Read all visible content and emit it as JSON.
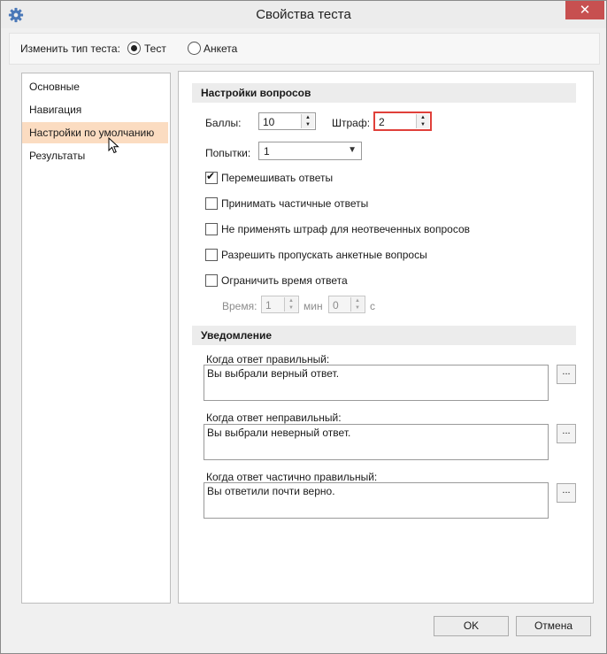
{
  "window": {
    "title": "Свойства теста",
    "icon": "gear-icon",
    "close_label": "✕"
  },
  "test_type": {
    "label": "Изменить тип теста:",
    "options": [
      {
        "label": "Тест",
        "selected": true
      },
      {
        "label": "Анкета",
        "selected": false
      }
    ]
  },
  "nav": {
    "items": [
      {
        "label": "Основные"
      },
      {
        "label": "Навигация"
      },
      {
        "label": "Настройки по умолчанию",
        "selected": true
      },
      {
        "label": "Результаты"
      }
    ]
  },
  "questions": {
    "header": "Настройки вопросов",
    "points_label": "Баллы:",
    "points_value": "10",
    "penalty_label": "Штраф:",
    "penalty_value": "2",
    "attempts_label": "Попытки:",
    "attempts_value": "1",
    "checkboxes": [
      {
        "label": "Перемешивать ответы",
        "checked": true
      },
      {
        "label": "Принимать частичные ответы",
        "checked": false
      },
      {
        "label": "Не применять штраф для неотвеченных вопросов",
        "checked": false
      },
      {
        "label": "Разрешить пропускать анкетные вопросы",
        "checked": false
      },
      {
        "label": "Ограничить время ответа",
        "checked": false
      }
    ],
    "time_label": "Время:",
    "time_min_value": "1",
    "time_min_unit": "мин",
    "time_sec_value": "0",
    "time_sec_unit": "с"
  },
  "notification": {
    "header": "Уведомление",
    "correct_label": "Когда ответ правильный:",
    "correct_text": "Вы выбрали верный ответ.",
    "incorrect_label": "Когда ответ неправильный:",
    "incorrect_text": "Вы выбрали неверный ответ.",
    "partial_label": "Когда ответ частично правильный:",
    "partial_text": "Вы ответили почти верно.",
    "browse_label": "..."
  },
  "buttons": {
    "ok": "OK",
    "cancel": "Отмена"
  },
  "colors": {
    "selected_nav": "#fbdcc1",
    "close_button": "#c75050",
    "highlight_border": "#e0403a"
  }
}
